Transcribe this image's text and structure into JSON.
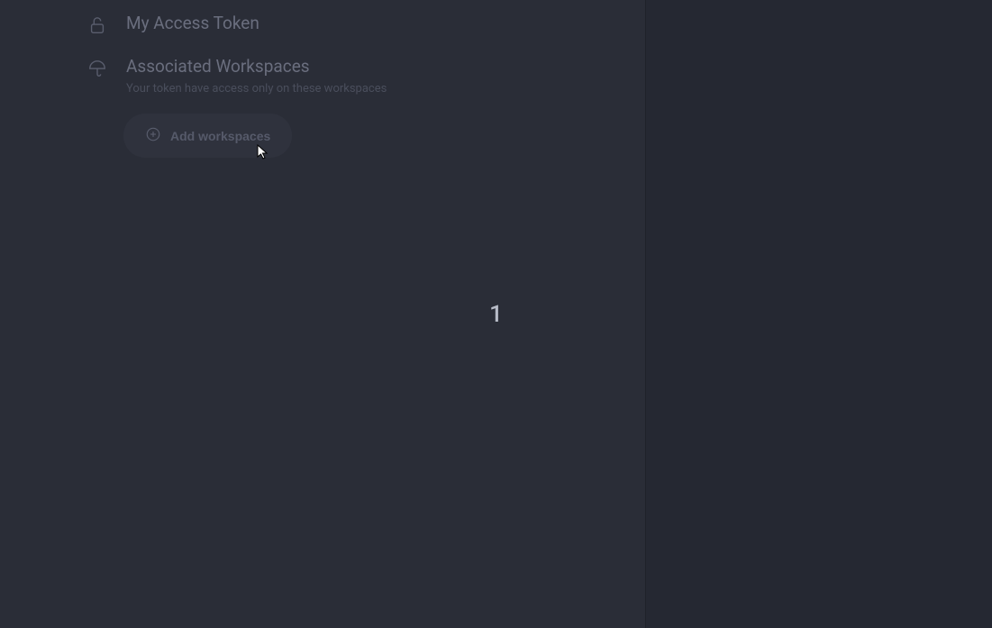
{
  "token_section": {
    "title": "My Access Token"
  },
  "workspaces_section": {
    "title": "Associated Workspaces",
    "subtitle": "Your token have access only on these workspaces"
  },
  "add_button": {
    "label": "Add workspaces"
  },
  "center_indicator": "1"
}
